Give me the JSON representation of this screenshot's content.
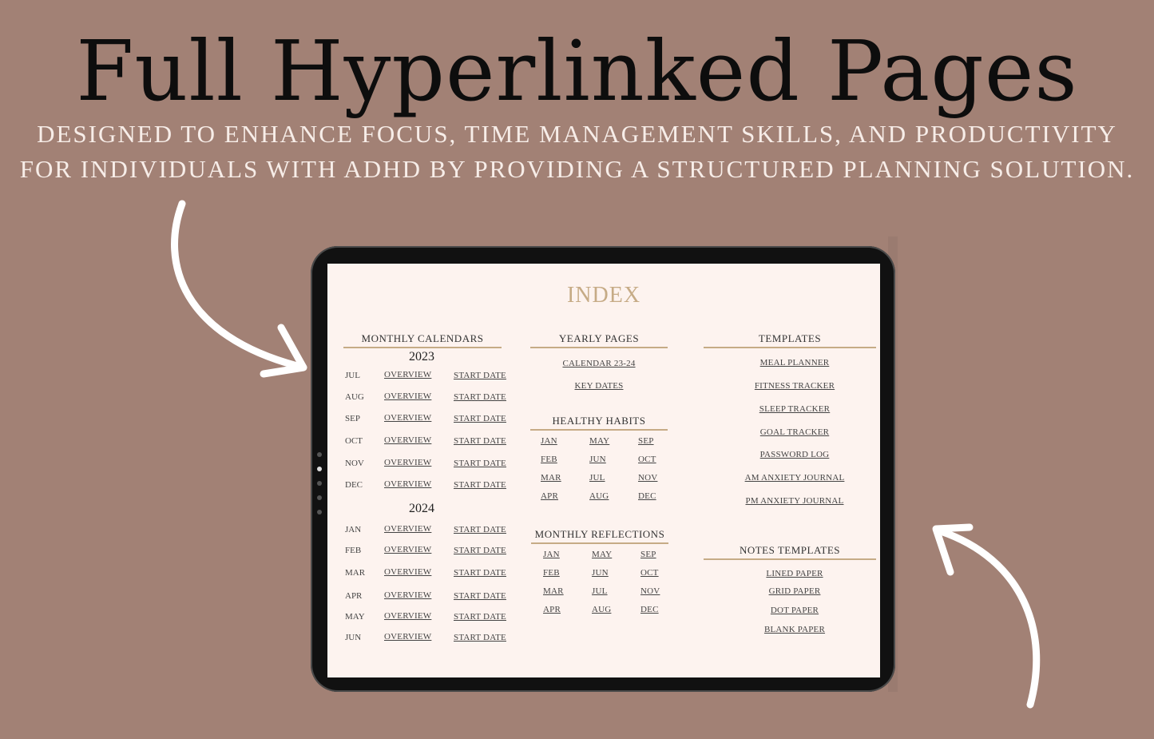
{
  "headline": "Full Hyperlinked Pages",
  "subtitle": {
    "line1": "DESIGNED TO ENHANCE FOCUS, TIME MANAGEMENT SKILLS, AND PRODUCTIVITY",
    "line2": "FOR INDIVIDUALS WITH ADHD BY PROVIDING A STRUCTURED PLANNING SOLUTION."
  },
  "colors": {
    "background": "#a28175",
    "accent": "#c6ab86",
    "screen": "#fdf3ef",
    "title": "#0d0d0d"
  },
  "index": {
    "title": "INDEX",
    "monthly": {
      "title": "MONTHLY CALENDARS",
      "overview_label": "OVERVIEW",
      "start_label": "START DATE",
      "years": [
        {
          "year": "2023",
          "months": [
            "JUL",
            "AUG",
            "SEP",
            "OCT",
            "NOV",
            "DEC"
          ]
        },
        {
          "year": "2024",
          "months": [
            "JAN",
            "FEB",
            "MAR",
            "APR",
            "MAY",
            "JUN"
          ]
        }
      ]
    },
    "yearly": {
      "title": "YEARLY PAGES",
      "items": [
        "CALENDAR 23-24",
        "KEY DATES"
      ]
    },
    "habits": {
      "title": "HEALTHY HABITS",
      "months": [
        "JAN",
        "FEB",
        "MAR",
        "APR",
        "MAY",
        "JUN",
        "JUL",
        "AUG",
        "SEP",
        "OCT",
        "NOV",
        "DEC"
      ]
    },
    "reflections": {
      "title": "MONTHLY REFLECTIONS",
      "months": [
        "JAN",
        "FEB",
        "MAR",
        "APR",
        "MAY",
        "JUN",
        "JUL",
        "AUG",
        "SEP",
        "OCT",
        "NOV",
        "DEC"
      ]
    },
    "templates": {
      "title": "TEMPLATES",
      "items": [
        "MEAL PLANNER",
        "FITNESS TRACKER",
        "SLEEP TRACKER",
        "GOAL TRACKER",
        "PASSWORD LOG",
        "AM ANXIETY JOURNAL",
        "PM ANXIETY JOURNAL"
      ]
    },
    "notes": {
      "title": "NOTES TEMPLATES",
      "items": [
        "LINED PAPER",
        "GRID PAPER",
        "DOT PAPER",
        "BLANK PAPER"
      ]
    }
  }
}
